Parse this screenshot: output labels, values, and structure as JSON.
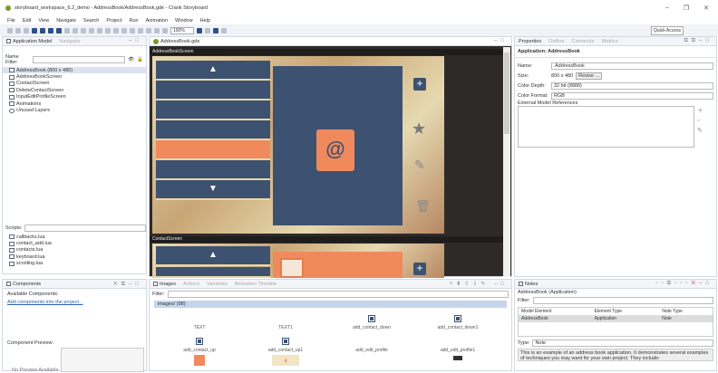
{
  "window": {
    "title": "storyboard_workspace_6.2_demo - AddressBook/AddressBook.gde - Crank Storyboard",
    "controls": [
      "–",
      "❐",
      "✕"
    ]
  },
  "menu": [
    "File",
    "Edit",
    "View",
    "Navigate",
    "Search",
    "Project",
    "Run",
    "Animation",
    "Window",
    "Help"
  ],
  "toolbar": {
    "zoom": "100%",
    "quick_access": "Quick Access"
  },
  "app_model": {
    "tabs": [
      "Application Model",
      "Navigator"
    ],
    "name_filter_label": "Name Filter:",
    "tree": [
      "AddressBook (800 x 480)",
      "AddressBookScreen",
      "ContactScreen",
      "DeleteContactScreen",
      "InputEditProfileScreen",
      "Animations",
      "Unused Layers"
    ],
    "scripts_label": "Scripts:",
    "scripts": [
      "callbacks.lua",
      "contact_add.lua",
      "contacts.lua",
      "keyboard.lua",
      "scrolling.lua"
    ]
  },
  "editor": {
    "tab": "AddressBook.gde",
    "screens": [
      "AddressBookScreen",
      "ContactScreen"
    ]
  },
  "properties": {
    "tabs": [
      "Properties",
      "Outline",
      "Connector",
      "Metrics"
    ],
    "heading": "Application: AddressBook",
    "name_label": "Name:",
    "name_value": "AddressBook",
    "size_label": "Size:",
    "size_value": "800 x 480",
    "resize_label": "Resize ...",
    "depth_label": "Color Depth:",
    "depth_value": "32 bit (8888)",
    "format_label": "Color Format:",
    "format_value": "RGB",
    "ext_label": "External Model References"
  },
  "components": {
    "tab": "Components",
    "available": "Available Components:",
    "link": "Add components into the project...",
    "preview": "Component Preview:",
    "no_preview": "No Preview Available"
  },
  "images": {
    "tabs": [
      "Images",
      "Actions",
      "Variables",
      "Animation Timeline"
    ],
    "filter_label": "Filter:",
    "folder": "images/ (98)",
    "items": [
      "TEXT",
      "TEXT1",
      "add_contact_down",
      "add_contact_down1",
      "add_contact_up",
      "add_contact_up1",
      "add_edit_profile",
      "add_edit_profile1"
    ]
  },
  "notes": {
    "tab": "Notes",
    "context": "AddressBook (Application)",
    "filter_label": "Filter:",
    "columns": [
      "Model Element",
      "Element Type",
      "Note Type"
    ],
    "row": [
      "AddressBook",
      "Application",
      "Note"
    ],
    "type_label": "Type:",
    "type_value": "Note",
    "text": "This is an example of an address book application. It demonstrates several examples of techniques you may want for your own project. They include:"
  },
  "colors": {
    "list_blue": "#3d5170",
    "accent_orange": "#f08a5d"
  }
}
